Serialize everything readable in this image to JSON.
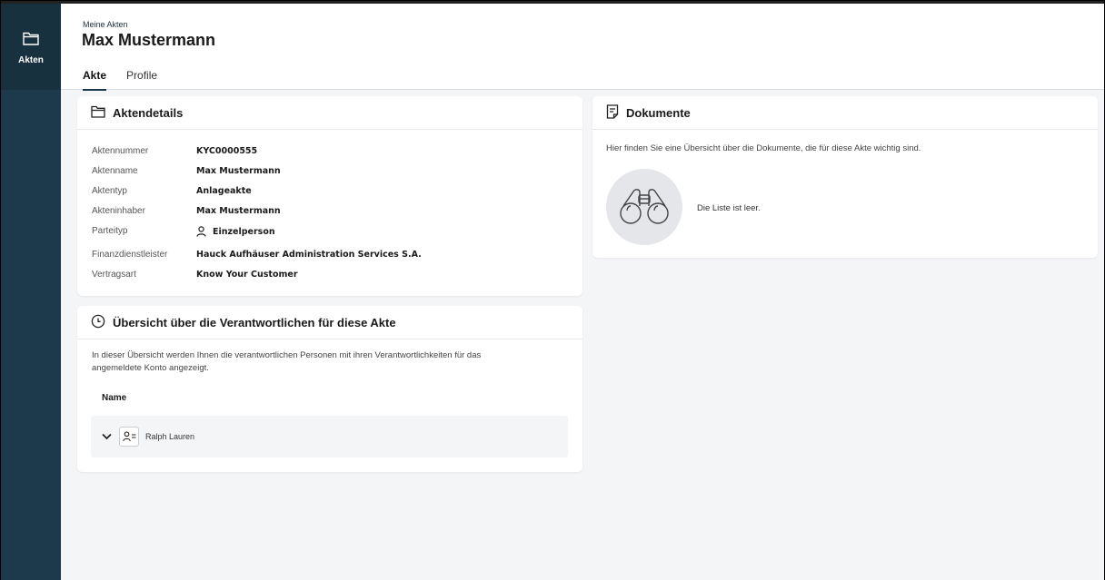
{
  "sidebar": {
    "items": [
      {
        "label": "Akten",
        "icon": "folder-icon"
      }
    ]
  },
  "header": {
    "breadcrumb": "Meine Akten",
    "title": "Max Mustermann"
  },
  "tabs": [
    {
      "label": "Akte",
      "active": true
    },
    {
      "label": "Profile",
      "active": false
    }
  ],
  "aktendetails": {
    "title": "Aktendetails",
    "rows": [
      {
        "key": "Aktennummer",
        "value": "KYC0000555"
      },
      {
        "key": "Aktenname",
        "value": "Max Mustermann"
      },
      {
        "key": "Aktentyp",
        "value": "Anlageakte"
      },
      {
        "key": "Akteninhaber",
        "value": "Max Mustermann"
      },
      {
        "key": "Parteityp",
        "value": "Einzelperson"
      },
      {
        "key": "Finanzdienstleister",
        "value": "Hauck Aufhäuser Administration Services S.A."
      },
      {
        "key": "Vertragsart",
        "value": "Know Your Customer"
      }
    ]
  },
  "verantwortliche": {
    "title": "Übersicht über die Verantwortlichen für diese Akte",
    "description_line1": "In dieser Übersicht werden Ihnen die verantwortlichen Personen mit ihren Verantwortlichkeiten für das",
    "description_line2": "angemeldete Konto angezeigt.",
    "column_header": "Name",
    "rows": [
      {
        "name": "Ralph Lauren"
      }
    ]
  },
  "dokumente": {
    "title": "Dokumente",
    "description": "Hier finden Sie eine Übersicht über die Dokumente, die für diese Akte wichtig sind.",
    "empty_text": "Die Liste ist leer."
  },
  "colors": {
    "sidebar": "#1d3a4c",
    "sidebar_active": "#17313f",
    "background": "#f4f5f7"
  }
}
